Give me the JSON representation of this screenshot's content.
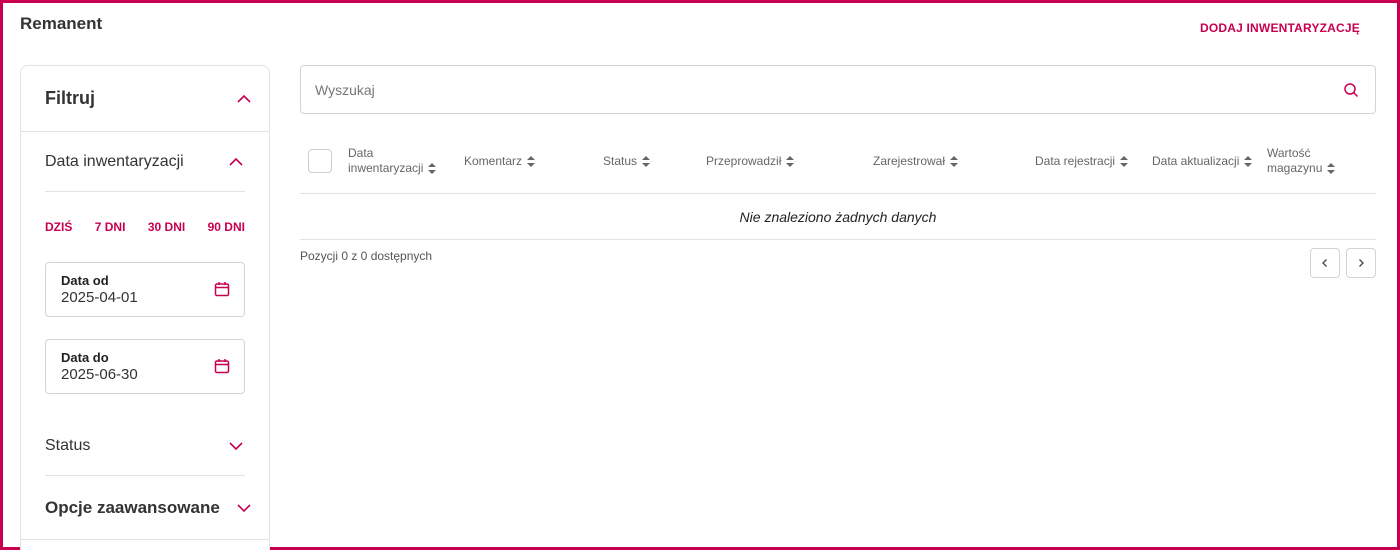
{
  "header": {
    "title": "Remanent",
    "add_button": "DODAJ INWENTARYZACJĘ"
  },
  "sidebar": {
    "title": "Filtruj",
    "date_section": {
      "label": "Data inwentaryzacji",
      "quick_ranges": [
        "DZIŚ",
        "7 DNI",
        "30 DNI",
        "90 DNI"
      ],
      "date_from": {
        "label": "Data od",
        "value": "2025-04-01"
      },
      "date_to": {
        "label": "Data do",
        "value": "2025-06-30"
      }
    },
    "status_label": "Status",
    "advanced_label": "Opcje zaawansowane"
  },
  "search": {
    "placeholder": "Wyszukaj",
    "value": ""
  },
  "table": {
    "columns": [
      "Data inwentaryzacji",
      "Komentarz",
      "Status",
      "Przeprowadził",
      "Zarejestrował",
      "Data rejestracji",
      "Data aktualizacji",
      "Wartość magazynu"
    ],
    "empty_text": "Nie znaleziono żadnych danych"
  },
  "pagination": {
    "info": "Pozycji 0 z 0 dostępnych"
  },
  "colors": {
    "accent": "#c8004f",
    "border": "#e2e2e2"
  },
  "icons": {
    "collapse": "chevron-up-icon",
    "expand": "chevron-down-icon",
    "calendar": "calendar-icon",
    "search": "search-icon",
    "sort": "sort-icon",
    "prev": "chevron-left-icon",
    "next": "chevron-right-icon"
  }
}
